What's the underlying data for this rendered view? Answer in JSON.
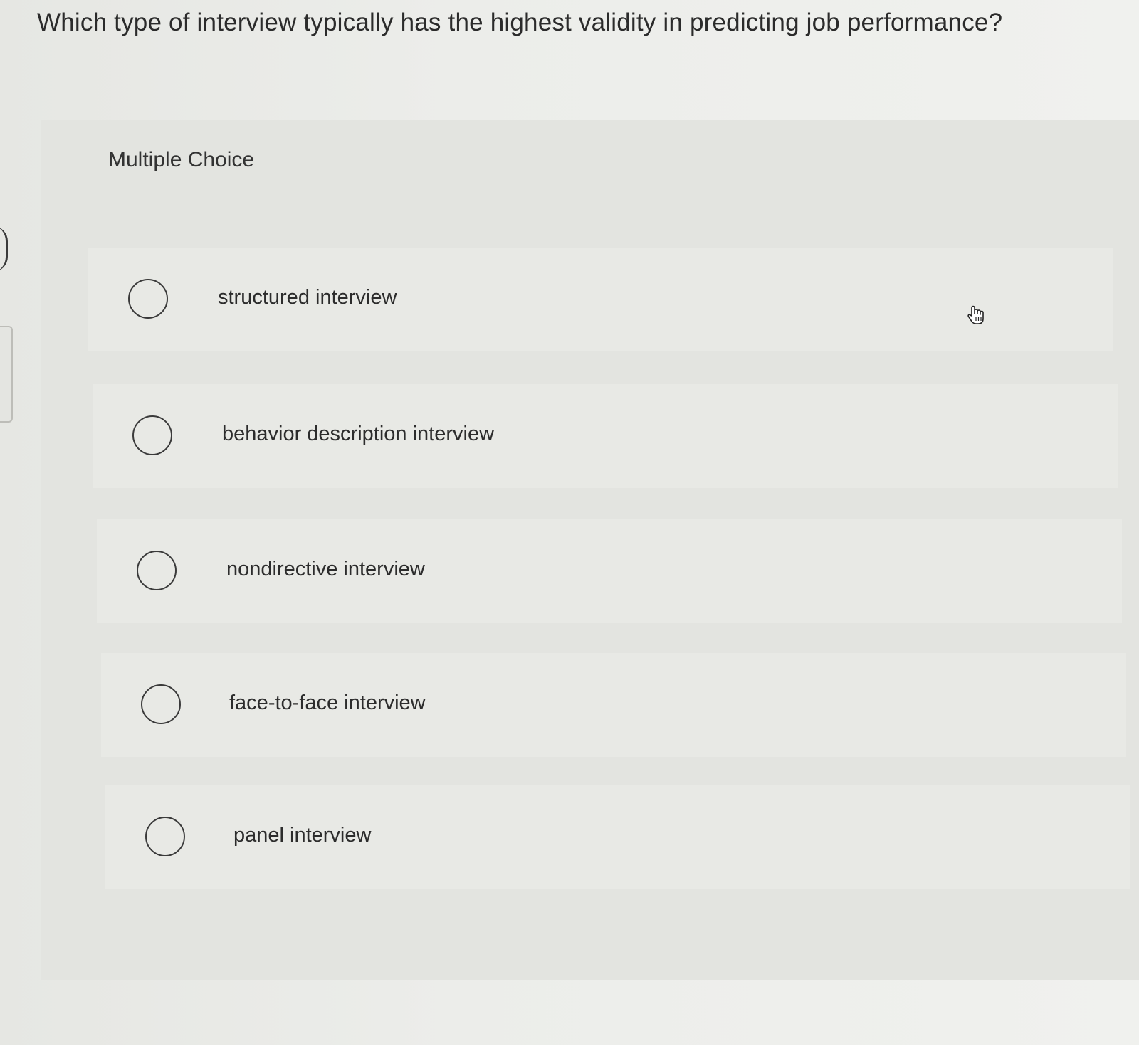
{
  "question": {
    "text": "Which type of interview typically has the highest validity in predicting job performance?"
  },
  "question_type": "Multiple Choice",
  "options": [
    {
      "label": "structured interview",
      "selected": false
    },
    {
      "label": "behavior description interview",
      "selected": false
    },
    {
      "label": "nondirective interview",
      "selected": false
    },
    {
      "label": "face-to-face interview",
      "selected": false
    },
    {
      "label": "panel interview",
      "selected": false
    }
  ],
  "cursor": {
    "icon": "pointer-hand-icon"
  },
  "colors": {
    "background": "#e9eae6",
    "panel": "#e3e4e0",
    "option_bg": "#e8e9e5",
    "text": "#2b2b2b",
    "radio_border": "#3a3a3a"
  }
}
